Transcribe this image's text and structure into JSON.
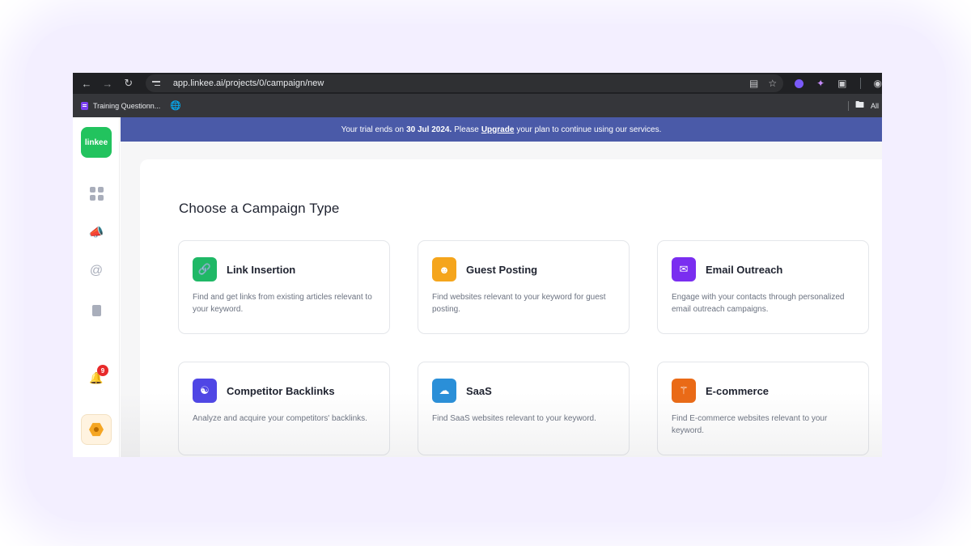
{
  "browser": {
    "url": "app.linkee.ai/projects/0/campaign/new",
    "nav_icons": [
      "back-arrow-icon",
      "forward-arrow-icon",
      "reload-icon"
    ],
    "bookmark_label": "Training Questionn...",
    "all_bookmarks_label": "All"
  },
  "sidebar": {
    "logo_text": "linkee",
    "notification_count": "9",
    "brand_color": "#22c35e"
  },
  "banner": {
    "text_before": "Your trial ends on",
    "date": "30 Jul 2024.",
    "text_mid": "Please",
    "link": "Upgrade",
    "text_after": "your plan to continue using our services.",
    "background": "#4a5aa8"
  },
  "main": {
    "title": "Choose a Campaign Type",
    "cards": [
      {
        "title": "Link Insertion",
        "description": "Find and get links from existing articles relevant to your keyword.",
        "icon": "link-icon",
        "color": "#1fb866"
      },
      {
        "title": "Guest Posting",
        "description": "Find websites relevant to your keyword for guest posting.",
        "icon": "user-icon",
        "color": "#f5a51c"
      },
      {
        "title": "Email Outreach",
        "description": "Engage with your contacts through personalized email outreach campaigns.",
        "icon": "mail-icon",
        "color": "#7a2ef0"
      },
      {
        "title": "Competitor Backlinks",
        "description": "Analyze and acquire your competitors' backlinks.",
        "icon": "group-icon",
        "color": "#4f46e5"
      },
      {
        "title": "SaaS",
        "description": "Find SaaS websites relevant to your keyword.",
        "icon": "cloud-icon",
        "color": "#2a8fd8"
      },
      {
        "title": "E-commerce",
        "description": "Find E-commerce websites relevant to your keyword.",
        "icon": "basket-icon",
        "color": "#ea6a16"
      }
    ]
  }
}
